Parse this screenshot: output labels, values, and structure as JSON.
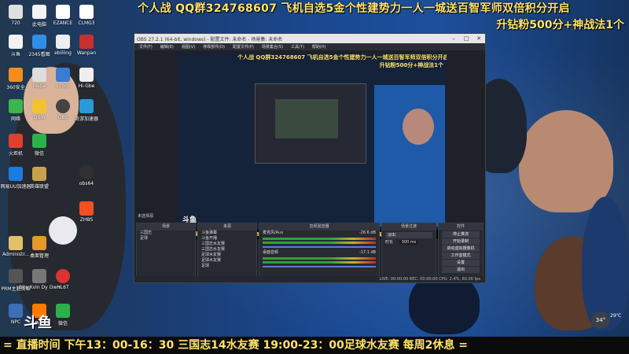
{
  "banner": {
    "top_line": "个人战 QQ群324768607 飞机自选5金个性建势力一人一城送百智军师双倍积分开启",
    "second_line": "升钻粉500分+神战法1个",
    "bottom_line": "= 直播时间 下午13：00-16：30 三国志14水友赛  19:00-23：00足球水友赛 每周2休息 ="
  },
  "desktop_icons": [
    {
      "label": "720"
    },
    {
      "label": "此电脑"
    },
    {
      "label": "EZANCE"
    },
    {
      "label": "CLMG3"
    },
    {
      "label": "斗鱼"
    },
    {
      "label": "2345看图"
    },
    {
      "label": "ebiliing"
    },
    {
      "label": "Wanpan"
    },
    {
      "label": "360安全"
    },
    {
      "label": "MeSe"
    },
    {
      "label": "Lcom"
    },
    {
      "label": "Hi-Gbe"
    },
    {
      "label": "网络"
    },
    {
      "label": "QSm"
    },
    {
      "label": "OBS"
    },
    {
      "label": "奇游加速器"
    },
    {
      "label": "火炬机"
    },
    {
      "label": "微信"
    },
    {
      "label": "obs64"
    },
    {
      "label": "网易UU加速器"
    },
    {
      "label": "英雄联盟"
    },
    {
      "label": "ZHBS"
    },
    {
      "label": "Administr..."
    },
    {
      "label": "桌面管理"
    },
    {
      "label": "PRM主题英雄"
    },
    {
      "label": "Bite Kvin Dy Own"
    },
    {
      "label": "HL6T"
    },
    {
      "label": "NPC"
    },
    {
      "label": "斗鱼直播"
    },
    {
      "label": "微信"
    }
  ],
  "obs": {
    "title": "OBS 27.2.1 (64-bit, windows) - 配置文件: 未命名 - 场景集: 未命名",
    "menu": [
      "文件(F)",
      "编辑(E)",
      "视图(V)",
      "停靠部件(D)",
      "配置文件(P)",
      "场景集合(S)",
      "工具(T)",
      "帮助(H)"
    ],
    "no_source": "未选择源",
    "scenes_title": "场景",
    "scenes": [
      "三国志",
      "足球"
    ],
    "sources_title": "来源",
    "sources": [
      "斗鱼弹幕",
      "斗鱼开播",
      "三国志水友赛",
      "三国志水友赛",
      "足球水友赛",
      "足球水友赛",
      "足球"
    ],
    "mixer_title": "音频混音器",
    "mixer_items": [
      "麦克风/Aux",
      "桌面音频"
    ],
    "mixer_db": [
      "-26.6 dB",
      "-17.1 dB"
    ],
    "transitions_title": "场景过渡",
    "transition_type": "淡出",
    "duration_label": "时长",
    "duration_value": "300 ms",
    "controls_title": "控件",
    "controls": [
      "停止推流",
      "开始录制",
      "启动虚拟摄像机",
      "工作室模式",
      "设置",
      "退出"
    ],
    "status": "LIVE: 00:00:00  REC: 00:00:00  CPU: 2.4%, 60.00 fps"
  },
  "tray": {
    "icon": "weather-icon",
    "temp_a": "29℃",
    "temp_b": "34°"
  },
  "logos": {
    "douyu_small": "斗鱼",
    "douyu_big": "斗鱼"
  },
  "colors": {
    "banner_yellow": "#ffe36a",
    "background_blue": "#1b4a92"
  }
}
